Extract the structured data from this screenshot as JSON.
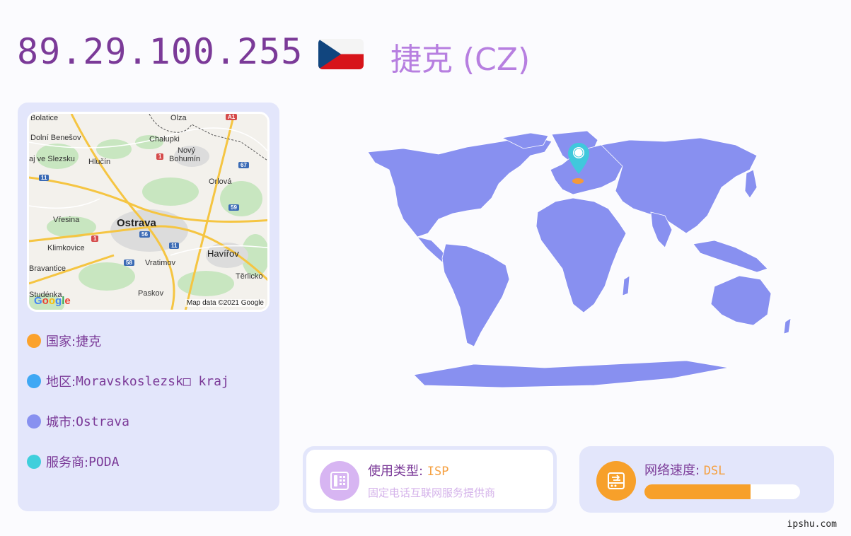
{
  "header": {
    "ip": "89.29.100.255",
    "country_title": "捷克 (CZ)",
    "flag_icon": "czech-flag-icon"
  },
  "map": {
    "labels": [
      "Bolatice",
      "Olza",
      "Dolní Benešov",
      "Chałupki",
      "Nový",
      "Bohumín",
      "aj ve Slezsku",
      "Hlučín",
      "Orlová",
      "Vřesina",
      "Ostrava",
      "Klimkovice",
      "Havířov",
      "Bravantice",
      "Vratimov",
      "Těrlicko",
      "Paskov",
      "Studénka"
    ],
    "shields": [
      "A1",
      "1",
      "67",
      "11",
      "59",
      "1",
      "56",
      "11",
      "58"
    ],
    "google": "Google",
    "attribution": "Map data ©2021 Google"
  },
  "info": [
    {
      "key": "国家: ",
      "value": "捷克",
      "color": "#fba22c"
    },
    {
      "key": "地区: ",
      "value": "Moravskoslezsk□ kraj",
      "color": "#3fa8f4"
    },
    {
      "key": "城市: ",
      "value": "Ostrava",
      "color": "#8891f0"
    },
    {
      "key": "服务商: ",
      "value": "PODA",
      "color": "#3fcfdc"
    }
  ],
  "usage": {
    "label": "使用类型: ",
    "value": "ISP",
    "sub": "固定电话互联网服务提供商",
    "icon": "telephone-icon"
  },
  "speed": {
    "label": "网络速度: ",
    "value": "DSL",
    "level": 0.68,
    "icon": "network-drive-icon"
  },
  "footer": {
    "site": "ipshu.com"
  },
  "colors": {
    "accent": "#7b3a98",
    "map_fill": "#8890f0",
    "marker": "#40c8dc",
    "highlight": "#f59a3a"
  }
}
